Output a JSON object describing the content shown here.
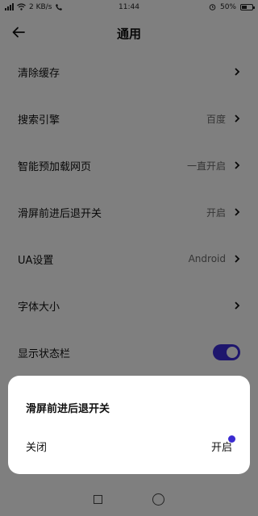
{
  "status_bar": {
    "speed": "2 KB/s",
    "time": "11:44",
    "battery": "50%",
    "icons": [
      "signal-icon",
      "wifi-icon",
      "hd-call-icon",
      "alarm-icon",
      "battery-icon"
    ]
  },
  "header": {
    "title": "通用",
    "back_icon": "back-arrow-icon"
  },
  "settings": [
    {
      "label": "清除缓存",
      "value": ""
    },
    {
      "label": "搜索引擎",
      "value": "百度"
    },
    {
      "label": "智能预加载网页",
      "value": "一直开启"
    },
    {
      "label": "滑屏前进后退开关",
      "value": "开启"
    },
    {
      "label": "UA设置",
      "value": "Android"
    },
    {
      "label": "字体大小",
      "value": ""
    },
    {
      "label": "显示状态栏",
      "toggle_on": true
    }
  ],
  "dialog": {
    "title": "滑屏前进后退开关",
    "option_off": "关闭",
    "option_on": "开启",
    "selected": "开启"
  },
  "colors": {
    "accent": "#3b2bd1",
    "overlay": "rgba(0,0,0,0.48)"
  }
}
